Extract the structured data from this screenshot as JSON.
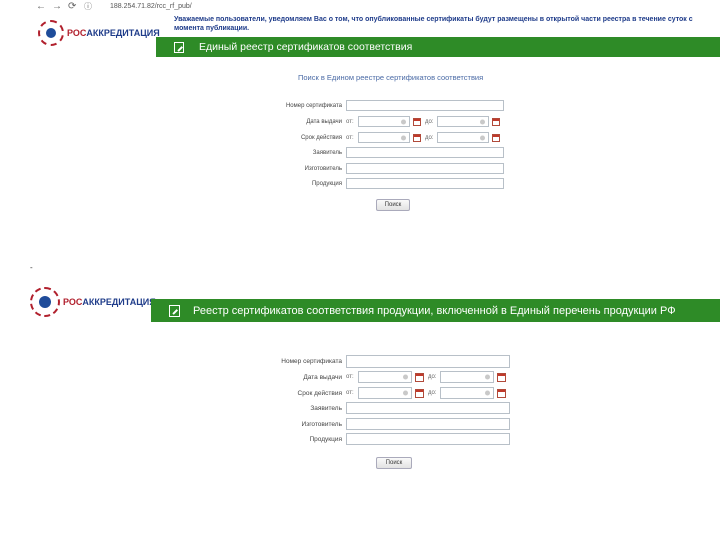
{
  "browser": {
    "back_icon": "arrow-left-icon",
    "forward_icon": "arrow-right-icon",
    "reload_icon": "reload-icon",
    "url": "188.254.71.82/rcc_rf_pub/"
  },
  "notice": "Уважаемые пользователи, уведомляем Вас о том, что опубликованные сертификаты будут размещены в открытой части реестра в течение суток с момента публикации.",
  "panel1": {
    "logo_a": "РОС",
    "logo_b": "АККРЕДИТАЦИЯ",
    "header_title": "Единый реестр сертификатов соответствия",
    "search_title": "Поиск в Едином реестре сертификатов соответствия",
    "labels": {
      "cert_number": "Номер сертификата",
      "issue_date": "Дата выдачи",
      "validity": "Срок действия",
      "applicant": "Заявитель",
      "manufacturer": "Изготовитель",
      "product": "Продукция"
    },
    "from": "от:",
    "to": "до:",
    "search_button": "Поиск"
  },
  "separator": "-",
  "panel2": {
    "logo_a": "РОС",
    "logo_b": "АККРЕДИТАЦИЯ",
    "header_title": "Реестр сертификатов соответствия продукции, включенной в Единый перечень продукции РФ",
    "labels": {
      "cert_number": "Номер сертификата",
      "issue_date": "Дата выдачи",
      "validity": "Срок действия",
      "applicant": "Заявитель",
      "manufacturer": "Изготовитель",
      "product": "Продукция"
    },
    "from": "от:",
    "to": "до:",
    "search_button": "Поиск"
  },
  "colors": {
    "green": "#2e8b27",
    "brand_blue": "#1f3c8a",
    "brand_red": "#b1202d"
  }
}
